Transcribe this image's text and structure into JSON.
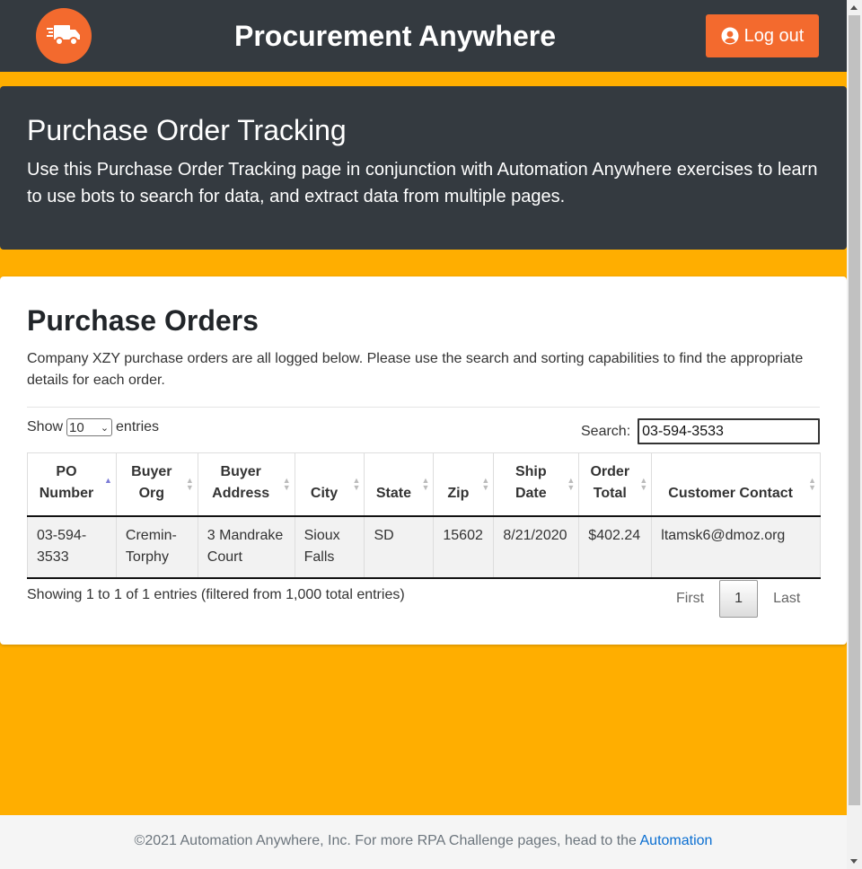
{
  "navbar": {
    "brand": "Procurement Anywhere",
    "logo_icon": "truck-icon",
    "logout_label": "Log out",
    "logout_icon": "user-circle-icon",
    "colors": {
      "bg": "#343a40",
      "accent": "#f36a2e"
    }
  },
  "jumbotron": {
    "title": "Purchase Order Tracking",
    "text": "Use this Purchase Order Tracking page in conjunction with Automation Anywhere exercises to learn to use bots to search for data, and extract data from multiple pages."
  },
  "orders": {
    "title": "Purchase Orders",
    "description": "Company XZY purchase orders are all logged below. Please use the search and sorting capabilities to find the appropriate details for each order.",
    "length": {
      "prefix": "Show",
      "selected": "10",
      "suffix": "entries"
    },
    "search": {
      "label": "Search:",
      "value": "03-594-3533"
    },
    "columns": [
      "PO Number",
      "Buyer Org",
      "Buyer Address",
      "City",
      "State",
      "Zip",
      "Ship Date",
      "Order Total",
      "Customer Contact"
    ],
    "rows": [
      [
        "03-594-3533",
        "Cremin-Torphy",
        "3 Mandrake Court",
        "Sioux Falls",
        "SD",
        "15602",
        "8/21/2020",
        "$402.24",
        "ltamsk6@dmoz.org"
      ]
    ],
    "info": "Showing 1 to 1 of 1 entries (filtered from 1,000 total entries)",
    "pagination": {
      "first": "First",
      "current": "1",
      "last": "Last"
    }
  },
  "footer": {
    "text": "©2021 Automation Anywhere, Inc. For more RPA Challenge pages, head to the ",
    "link": "Automation"
  },
  "colors": {
    "page_bg": "#ffae00",
    "link": "#0a6ed1"
  }
}
